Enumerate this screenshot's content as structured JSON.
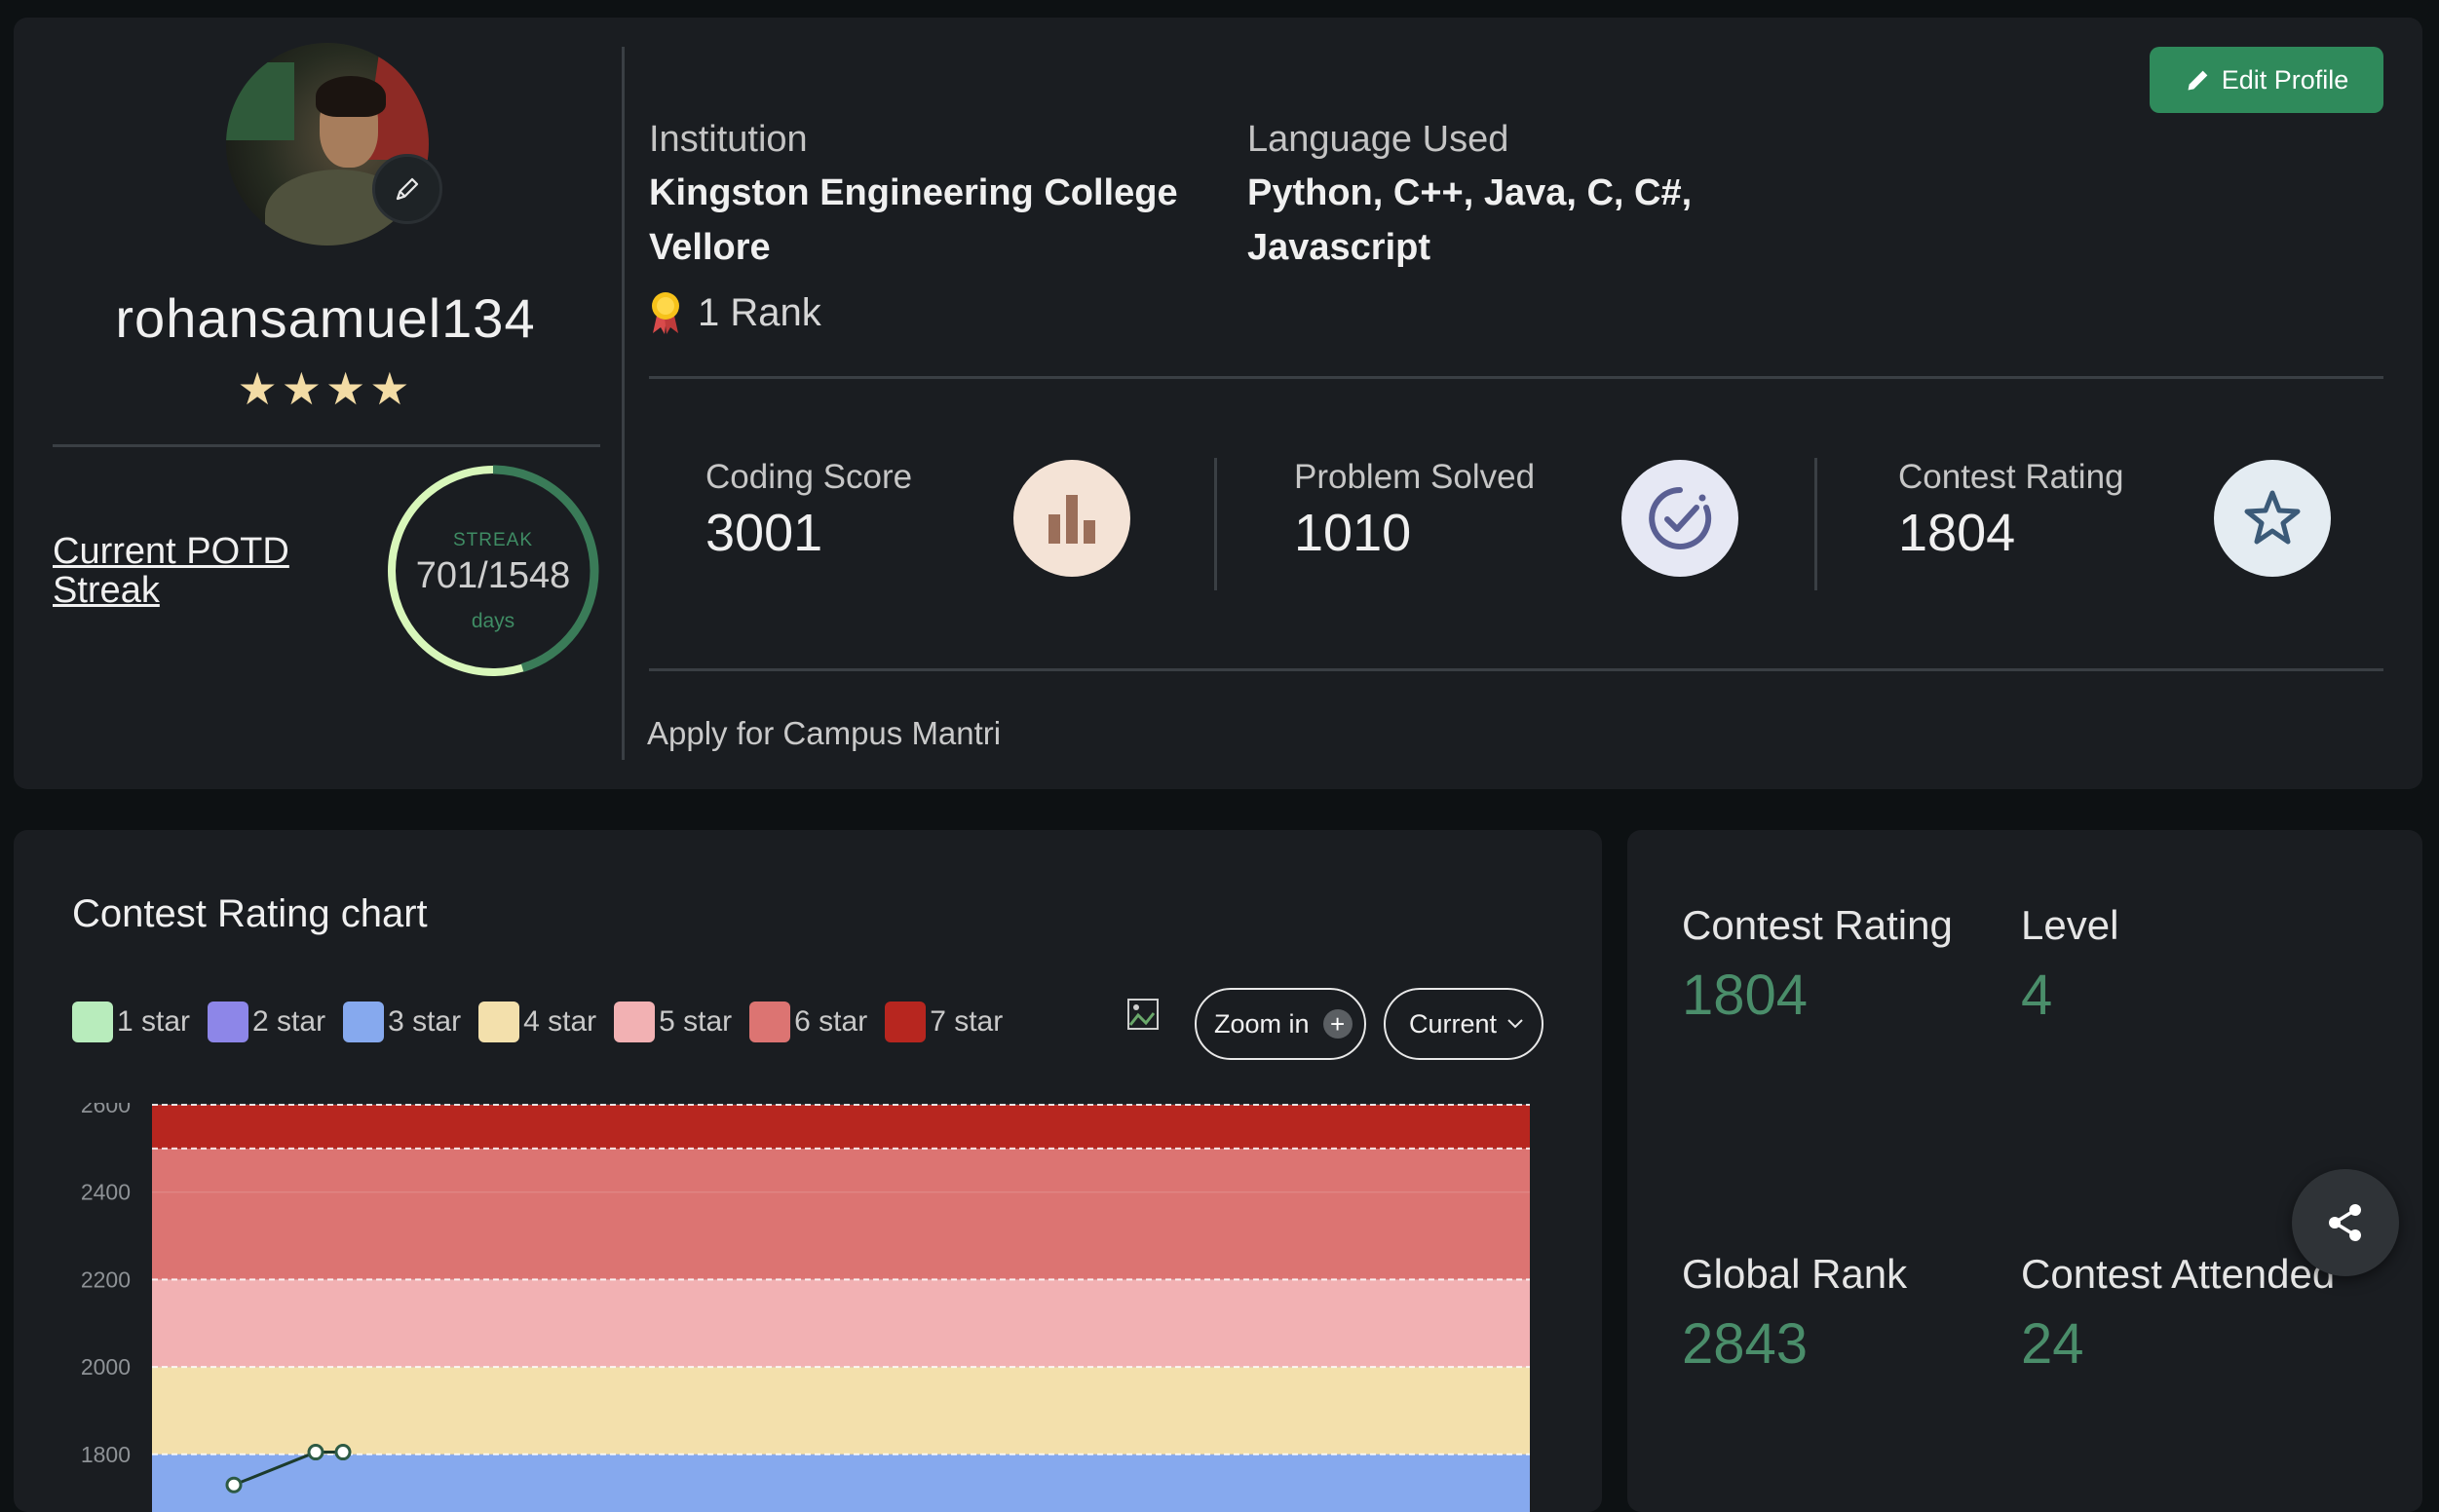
{
  "profile": {
    "username": "rohansamuel134",
    "stars": "★★★★",
    "potd_label": "Current POTD Streak",
    "streak": {
      "label": "STREAK",
      "value": "701/1548",
      "unit": "days",
      "progress": 0.453
    }
  },
  "info": {
    "institution_label": "Institution",
    "institution_line1": "Kingston Engineering College",
    "institution_line2": "Vellore",
    "rank_text": "1 Rank",
    "language_label": "Language Used",
    "language_line1": "Python, C++, Java, C, C#,",
    "language_line2": "Javascript"
  },
  "edit_profile_label": "Edit Profile",
  "stats": [
    {
      "label": "Coding Score",
      "value": "3001",
      "icon": "bar-chart-icon",
      "icon_bg": "#f4e3d6",
      "icon_color": "#9b6f5a"
    },
    {
      "label": "Problem Solved",
      "value": "1010",
      "icon": "check-badge-icon",
      "icon_bg": "#e6e8f4",
      "icon_color": "#5a5f93"
    },
    {
      "label": "Contest Rating",
      "value": "1804",
      "icon": "star-outline-icon",
      "icon_bg": "#e4ecf2",
      "icon_color": "#3b5a78"
    }
  ],
  "campus_link": "Apply for Campus Mantri",
  "chart_panel": {
    "title": "Contest Rating chart",
    "zoom_label": "Zoom in",
    "zoom_icon": "+",
    "select_value": "Current",
    "legend": [
      {
        "label": "1 star",
        "color": "#b8ecbc"
      },
      {
        "label": "2 star",
        "color": "#8d86e8"
      },
      {
        "label": "3 star",
        "color": "#86a9ee"
      },
      {
        "label": "4 star",
        "color": "#f3e0ac"
      },
      {
        "label": "5 star",
        "color": "#f2b1b3"
      },
      {
        "label": "6 star",
        "color": "#dc7472"
      },
      {
        "label": "7 star",
        "color": "#b7261f"
      }
    ]
  },
  "chart_data": {
    "type": "line",
    "ylim": [
      1750,
      2600
    ],
    "yticks": [
      1800,
      2000,
      2200,
      2400,
      2600
    ],
    "bands": [
      {
        "from": 1600,
        "to": 1800,
        "color": "#86a9ee"
      },
      {
        "from": 1800,
        "to": 2000,
        "color": "#f3e0ac"
      },
      {
        "from": 2000,
        "to": 2200,
        "color": "#f2b1b3"
      },
      {
        "from": 2200,
        "to": 2500,
        "color": "#dc7472"
      },
      {
        "from": 2500,
        "to": 2600,
        "color": "#b7261f"
      }
    ],
    "series": [
      {
        "values": [
          1730,
          1805,
          1805
        ]
      }
    ]
  },
  "side_stats": {
    "contest_rating_label": "Contest Rating",
    "contest_rating_value": "1804",
    "level_label": "Level",
    "level_value": "4",
    "global_rank_label": "Global Rank",
    "global_rank_value": "2843",
    "contests_label": "Contest Attended",
    "contests_value": "24"
  }
}
